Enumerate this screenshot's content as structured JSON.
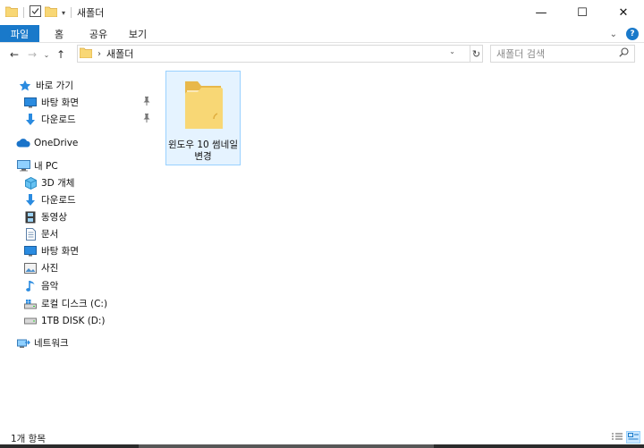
{
  "window": {
    "title": "새폴더",
    "minimize_glyph": "—",
    "maximize_glyph": "☐",
    "close_glyph": "✕"
  },
  "ribbon": {
    "tabs": [
      {
        "label": "파일"
      },
      {
        "label": "홈"
      },
      {
        "label": "공유"
      },
      {
        "label": "보기"
      }
    ],
    "expand_glyph": "⌄",
    "help_glyph": "?"
  },
  "address": {
    "back_glyph": "←",
    "forward_glyph": "→",
    "recent_glyph": "⌄",
    "up_glyph": "↑",
    "path": "새폴더",
    "separator": "›",
    "dropdown_glyph": "⌄",
    "refresh_glyph": "↻"
  },
  "search": {
    "placeholder": "새폴더 검색",
    "icon": "search-icon"
  },
  "nav": {
    "quick_access": "바로 가기",
    "desktop": "바탕 화면",
    "downloads": "다운로드",
    "onedrive": "OneDrive",
    "this_pc": "내 PC",
    "objects_3d": "3D 개체",
    "pc_downloads": "다운로드",
    "videos": "동영상",
    "documents": "문서",
    "pc_desktop": "바탕 화면",
    "pictures": "사진",
    "music": "음악",
    "local_disk": "로컬 디스크 (C:)",
    "disk_d": "1TB DISK (D:)",
    "network": "네트워크",
    "pin_glyph": "📌"
  },
  "content": {
    "items": [
      {
        "name": "윈도우 10 썸네일 변경",
        "type": "folder",
        "selected": true
      }
    ]
  },
  "status": {
    "item_count": "1개 항목"
  },
  "colors": {
    "accent": "#1979ca",
    "folder": "#f8d775",
    "folder_dark": "#e8b84a",
    "selection_bg": "#e5f3ff",
    "selection_border": "#99d1ff"
  }
}
